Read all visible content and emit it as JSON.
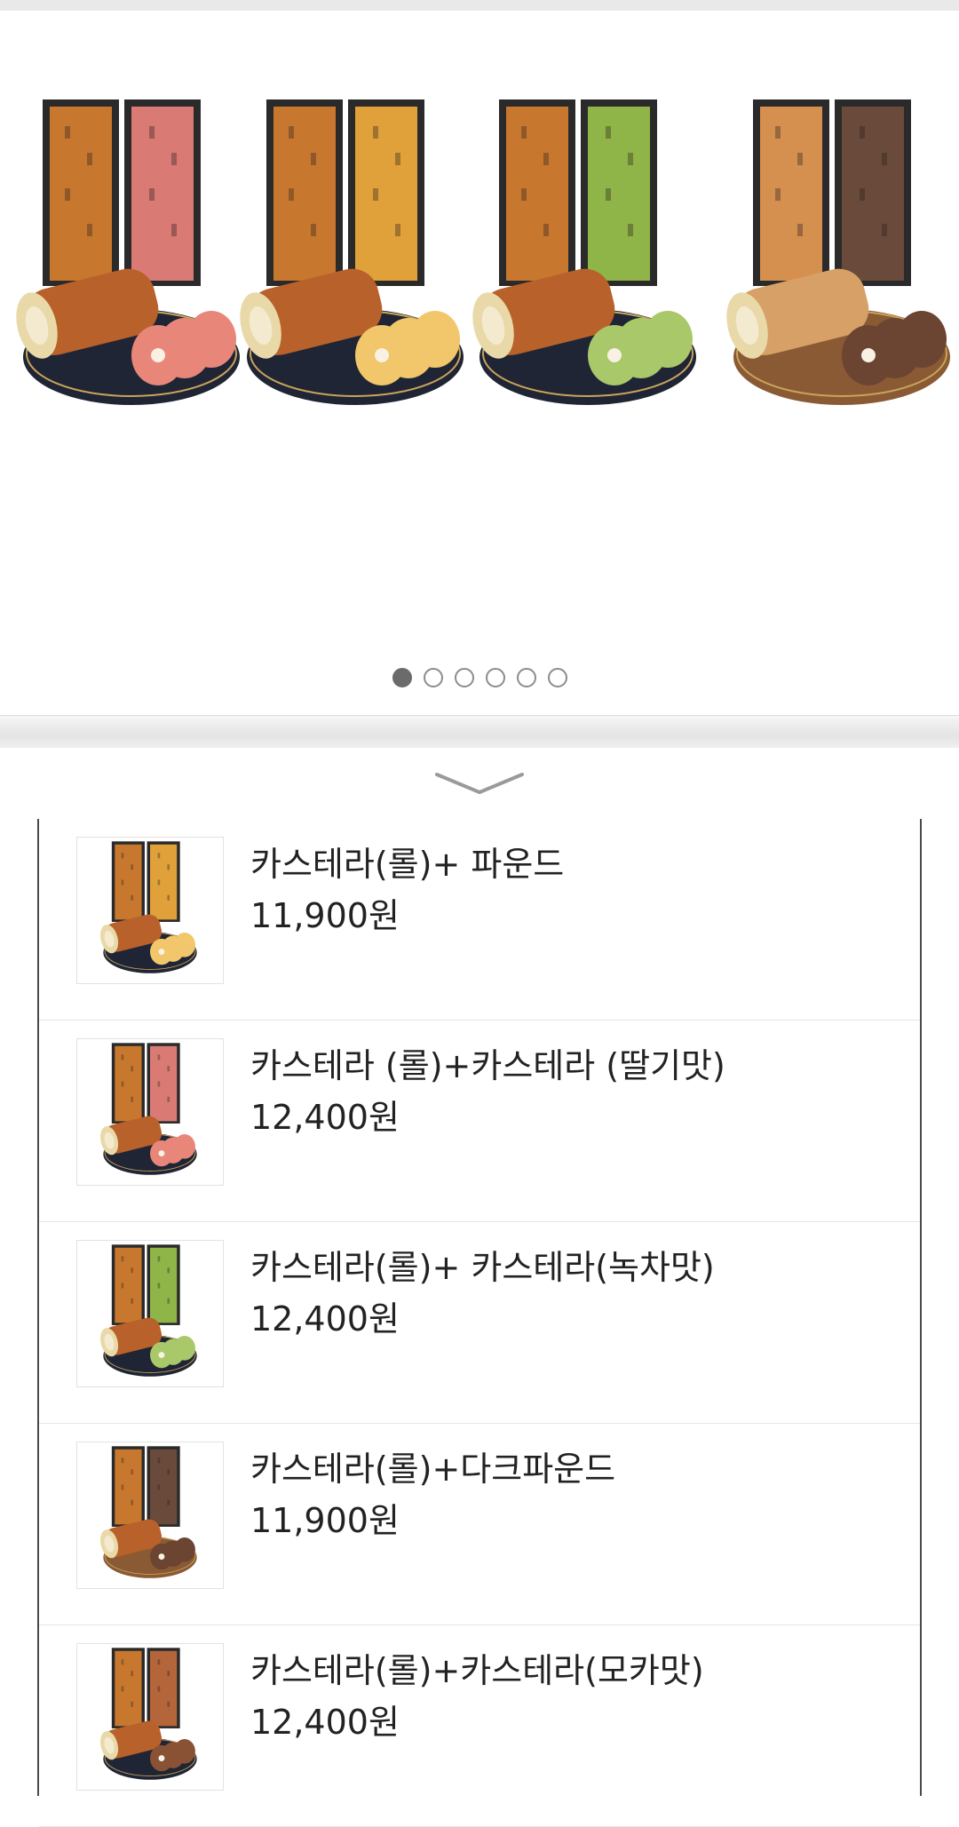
{
  "carousel": {
    "slide_count": 6,
    "active_index": 0,
    "slides": [
      {
        "name": "roll-strawberry",
        "left_box": "#c8782e",
        "right_box": "#d97a74",
        "roll_color": "#b8612a",
        "slice_color": "#e8867a",
        "plate": "#1f2535"
      },
      {
        "name": "roll-pound",
        "left_box": "#c8782e",
        "right_box": "#e0a03a",
        "roll_color": "#b8612a",
        "slice_color": "#f2c66a",
        "plate": "#1f2535"
      },
      {
        "name": "roll-greentea",
        "left_box": "#c8782e",
        "right_box": "#8fb448",
        "roll_color": "#b8612a",
        "slice_color": "#a8c86a",
        "plate": "#1f2535"
      },
      {
        "name": "roll-dark-pound",
        "left_box": "#d59050",
        "right_box": "#6a4a3a",
        "roll_color": "#d7a067",
        "slice_color": "#6b4432",
        "plate": "#8a5a34"
      }
    ]
  },
  "products": [
    {
      "name": "카스테라(롤)+ 파운드",
      "price": "11,900원",
      "right_color": "#e0a03a",
      "slice_color": "#f2c66a",
      "plate": "#1f2535"
    },
    {
      "name": "카스테라 (롤)+카스테라 (딸기맛)",
      "price": "12,400원",
      "right_color": "#d97a74",
      "slice_color": "#e8867a",
      "plate": "#1f2535"
    },
    {
      "name": "카스테라(롤)+ 카스테라(녹차맛)",
      "price": "12,400원",
      "right_color": "#8fb448",
      "slice_color": "#a8c86a",
      "plate": "#1f2535"
    },
    {
      "name": "카스테라(롤)+다크파운드",
      "price": "11,900원",
      "right_color": "#6a4a3a",
      "slice_color": "#6b4432",
      "plate": "#8a5a34"
    },
    {
      "name": "카스테라(롤)+카스테라(모카맛)",
      "price": "12,400원",
      "right_color": "#b5653a",
      "slice_color": "#8a5234",
      "plate": "#1f2535"
    }
  ]
}
